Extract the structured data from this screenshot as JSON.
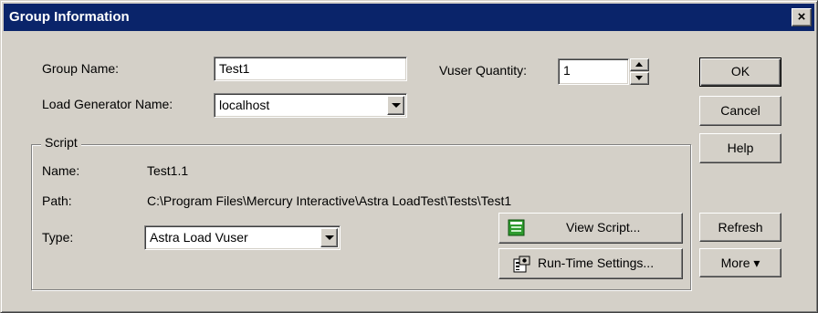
{
  "window": {
    "title": "Group Information",
    "close_glyph": "×"
  },
  "form": {
    "group_name_label": "Group Name:",
    "group_name_value": "Test1",
    "load_generator_label": "Load Generator Name:",
    "load_generator_value": "localhost",
    "vuser_quantity_label": "Vuser Quantity:",
    "vuser_quantity_value": "1"
  },
  "script": {
    "group_title": "Script",
    "name_label": "Name:",
    "name_value": "Test1.1",
    "path_label": "Path:",
    "path_value": "C:\\Program Files\\Mercury Interactive\\Astra LoadTest\\Tests\\Test1",
    "type_label": "Type:",
    "type_value": "Astra Load Vuser",
    "view_script_label": "View Script...",
    "runtime_settings_label": "Run-Time Settings..."
  },
  "buttons": {
    "ok": "OK",
    "cancel": "Cancel",
    "help": "Help",
    "refresh": "Refresh",
    "more": "More ▾"
  },
  "icons": {
    "view_script": "script-window-icon",
    "runtime_settings": "settings-gear-icon"
  },
  "colors": {
    "titlebar": "#0a246a",
    "face": "#d4d0c8",
    "view_script_icon": "#2e9b2e"
  }
}
